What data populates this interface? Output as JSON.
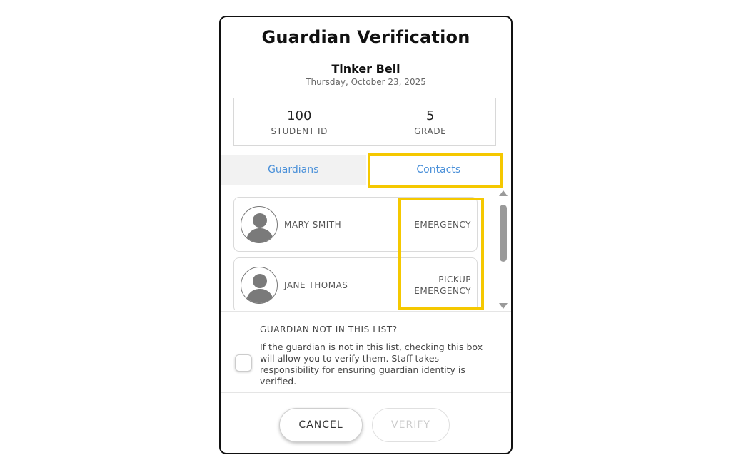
{
  "dialog": {
    "title": "Guardian Verification",
    "student_name": "Tinker Bell",
    "date": "Thursday, October 23, 2025"
  },
  "info": {
    "student_id": {
      "value": "100",
      "label": "STUDENT ID"
    },
    "grade": {
      "value": "5",
      "label": "GRADE"
    }
  },
  "tabs": [
    {
      "label": "Guardians",
      "active": false
    },
    {
      "label": "Contacts",
      "active": true
    }
  ],
  "contacts": [
    {
      "name": "MARY SMITH",
      "types": [
        "EMERGENCY"
      ],
      "icon": "person-avatar-icon"
    },
    {
      "name": "JANE THOMAS",
      "types": [
        "PICKUP",
        "EMERGENCY"
      ],
      "icon": "person-avatar-icon"
    }
  ],
  "not_in_list": {
    "heading": "GUARDIAN NOT IN THIS LIST?",
    "text": "If the guardian is not in this list, checking this box will allow you to verify them. Staff takes responsibility for ensuring guardian identity is verified.",
    "checked": false
  },
  "buttons": {
    "cancel": "CANCEL",
    "verify": "VERIFY"
  },
  "colors": {
    "accent": "#4a90d9",
    "highlight": "#f5c800",
    "muted": "#cccccc"
  }
}
